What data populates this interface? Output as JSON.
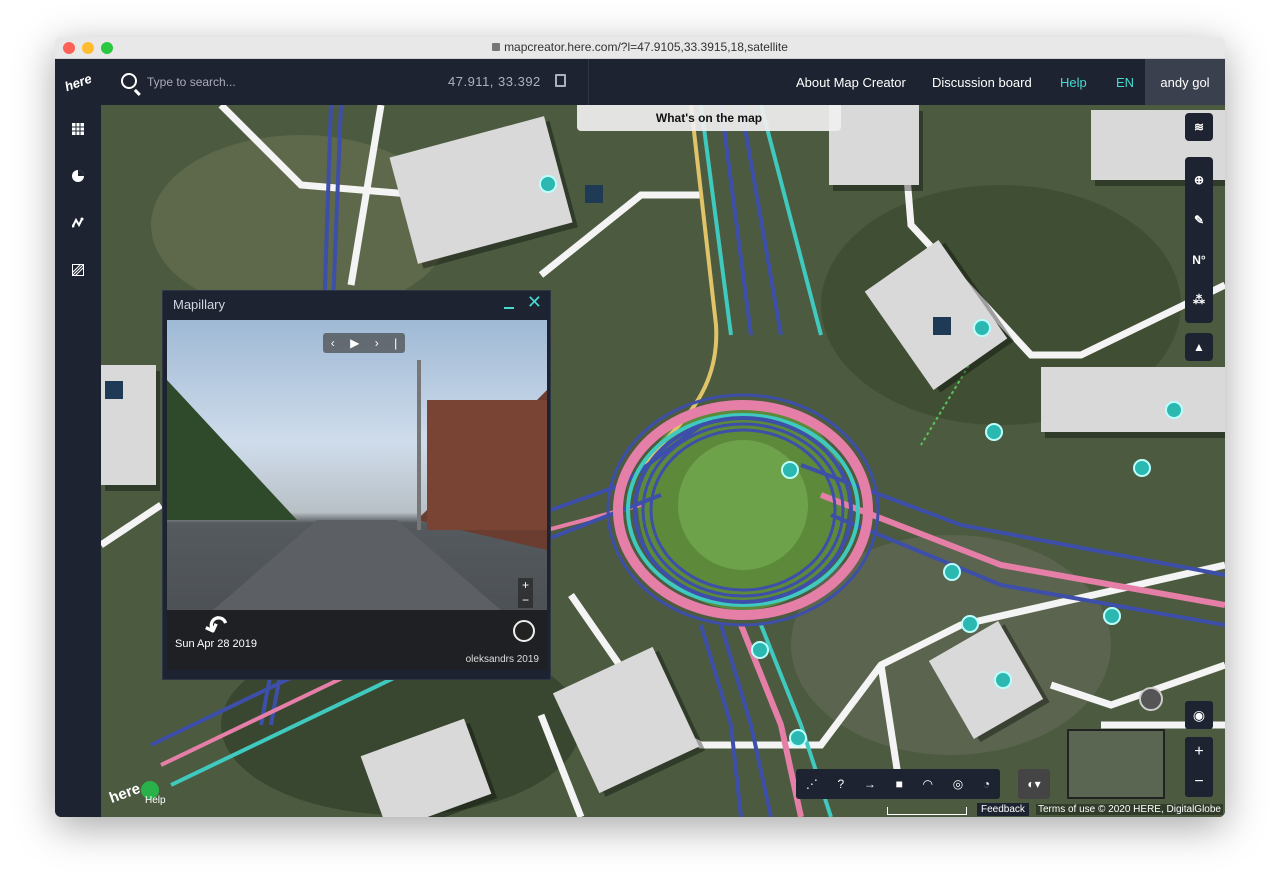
{
  "browser": {
    "url": "mapcreator.here.com/?l=47.9105,33.3915,18,satellite"
  },
  "header": {
    "logo": "here",
    "search_placeholder": "Type to search...",
    "coords": "47.911, 33.392",
    "nav": {
      "about": "About Map Creator",
      "discussion": "Discussion board",
      "help": "Help",
      "lang": "EN"
    },
    "user": "andy gol"
  },
  "map": {
    "whats_on": "What's on the map",
    "mapillary": {
      "title": "Mapillary",
      "date": "Sun Apr 28 2019",
      "author": "oleksandrs 2019"
    },
    "feedback": "Feedback",
    "terms": "Terms of use © 2020 HERE, DigitalGlobe",
    "help": "Help",
    "here_logo": "here"
  },
  "colors": {
    "accent": "#48dad0",
    "navy": "#1d2330",
    "road_blue": "#3d4fa8",
    "road_teal": "#3fc9bf",
    "road_pink": "#e67fa8"
  }
}
